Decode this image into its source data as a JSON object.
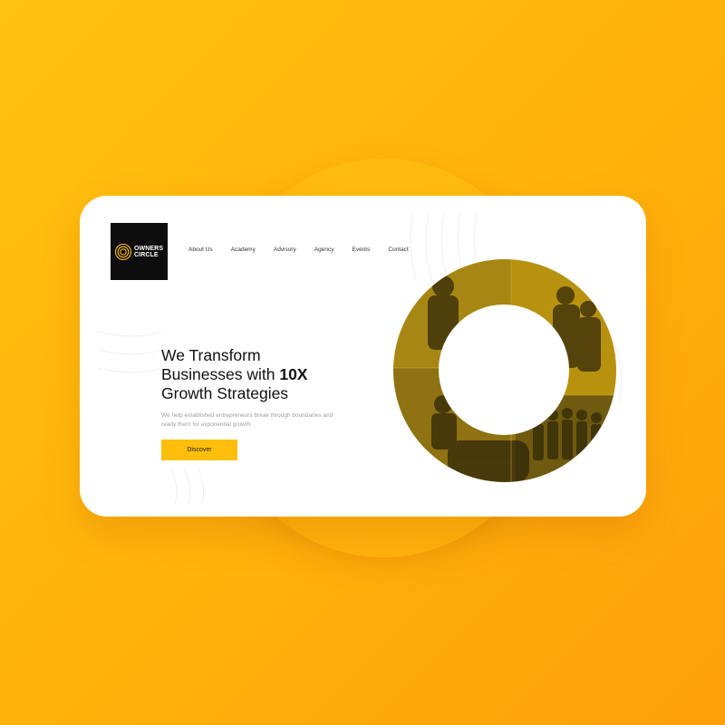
{
  "logo": {
    "line1": "OWNERS",
    "line2": "CIRCLE"
  },
  "nav": {
    "items": [
      "About Us",
      "Academy",
      "Advisory",
      "Agency",
      "Events",
      "Contact"
    ]
  },
  "hero": {
    "headline_line1": "We Transform",
    "headline_line2_prefix": "Businesses with ",
    "headline_line2_emphasis": "10X",
    "headline_line3": "Growth Strategies",
    "subtext": "We help established entrepreneurs break through boundaries and ready them for exponential growth.",
    "cta_label": "Discover"
  },
  "colors": {
    "background": "#ffb70c",
    "accent": "#ffbe0c",
    "logo_bg": "#0d0d0d",
    "text": "#111111",
    "muted": "#a0a0a0"
  },
  "icons": [
    "owners-circle-logo-icon"
  ]
}
